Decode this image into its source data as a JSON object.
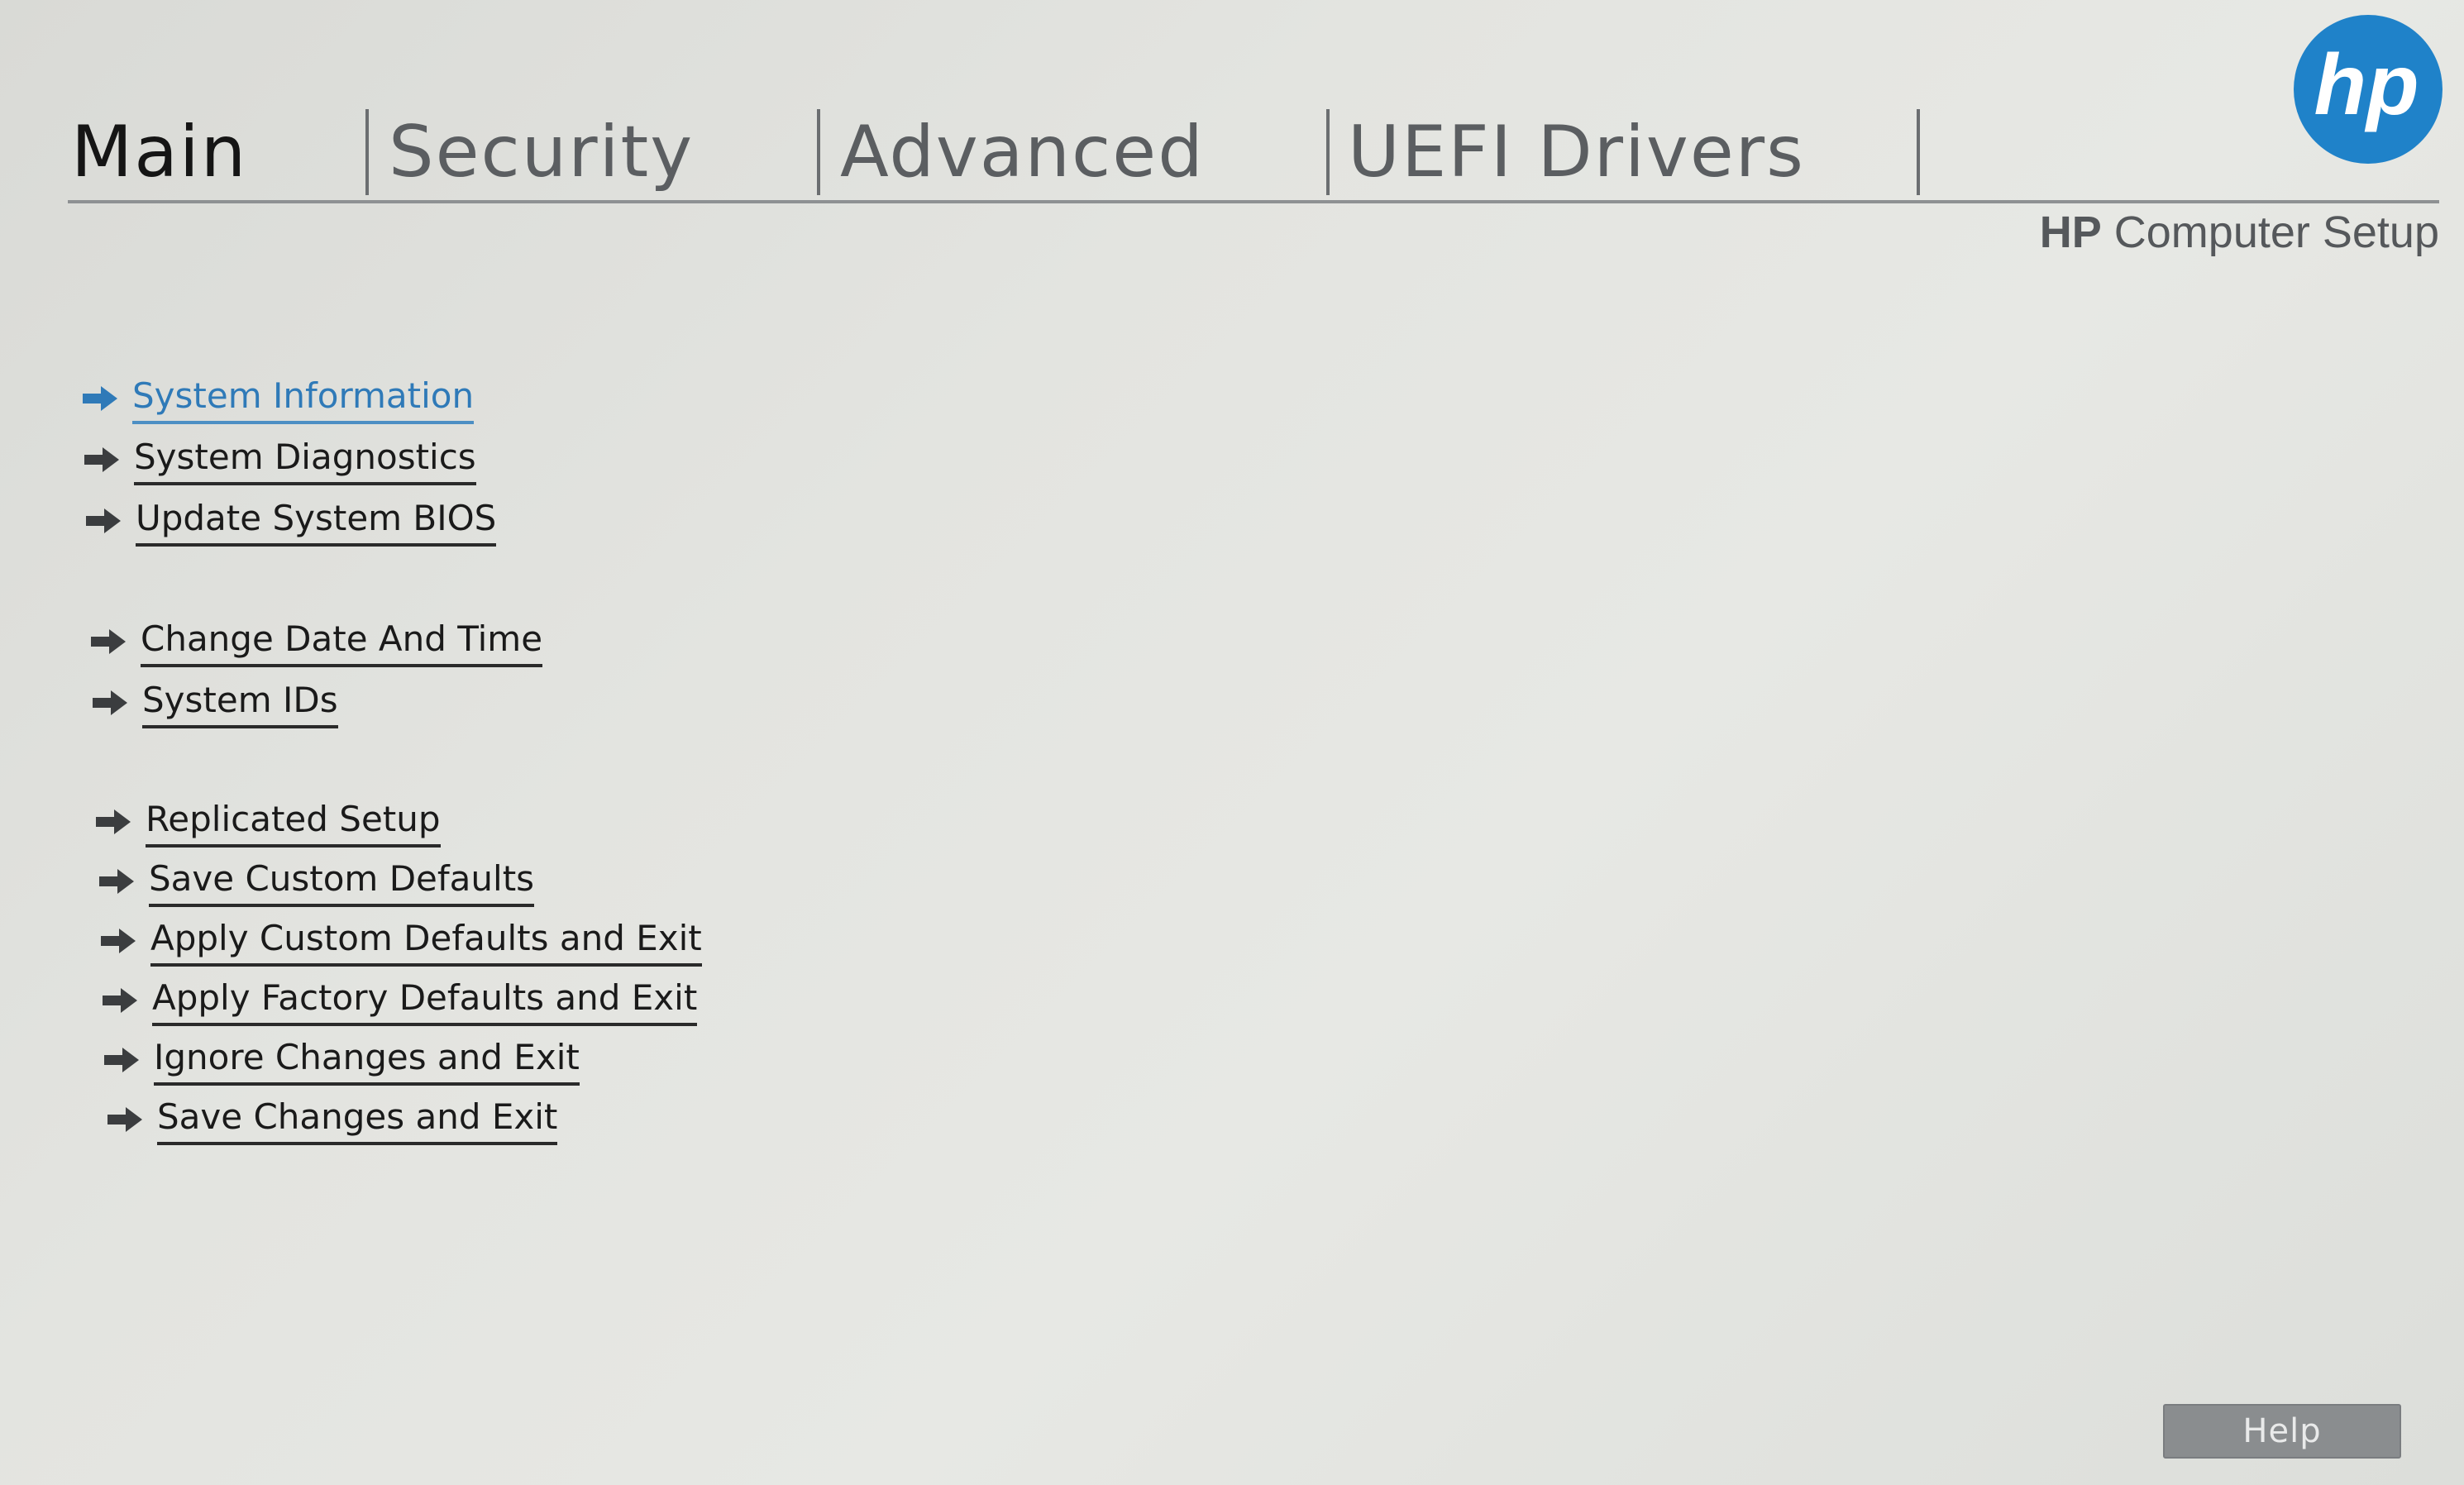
{
  "tabs": [
    {
      "label": "Main",
      "active": true
    },
    {
      "label": "Security",
      "active": false
    },
    {
      "label": "Advanced",
      "active": false
    },
    {
      "label": "UEFI Drivers",
      "active": false
    }
  ],
  "branding": {
    "logo_text": "hp",
    "brand": "HP",
    "product": "Computer Setup",
    "logo_color": "#1f82c9"
  },
  "menu": {
    "items": [
      {
        "label": "System Information",
        "selected": true
      },
      {
        "label": "System Diagnostics",
        "selected": false
      },
      {
        "label": "Update System BIOS",
        "selected": false
      },
      {
        "label": "Change Date And Time",
        "selected": false
      },
      {
        "label": "System IDs",
        "selected": false
      },
      {
        "label": "Replicated Setup",
        "selected": false
      },
      {
        "label": "Save Custom Defaults",
        "selected": false
      },
      {
        "label": "Apply Custom Defaults and Exit",
        "selected": false
      },
      {
        "label": "Apply Factory Defaults and Exit",
        "selected": false
      },
      {
        "label": "Ignore Changes and Exit",
        "selected": false
      },
      {
        "label": "Save Changes and Exit",
        "selected": false
      }
    ],
    "icon": "arrow-right-icon"
  },
  "footer": {
    "help_label": "Help"
  },
  "colors": {
    "selected": "#2f7ab8",
    "text": "#1a1a1a",
    "tab_inactive": "#5b5e61",
    "background": "#e3e4e0"
  }
}
